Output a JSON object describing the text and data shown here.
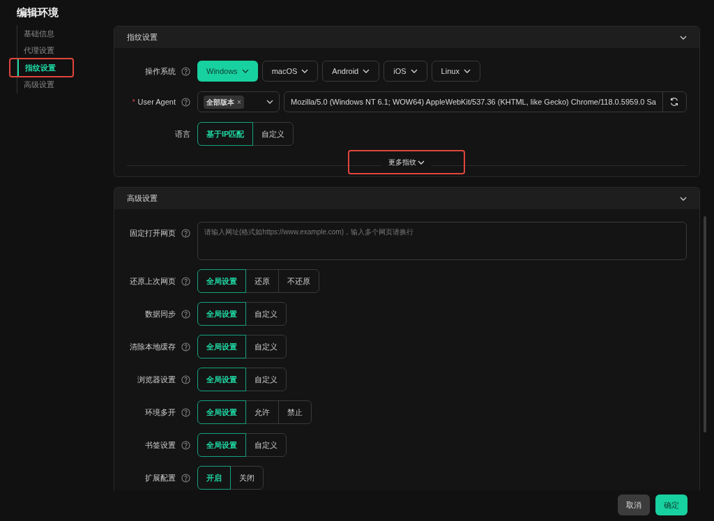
{
  "title": "编辑环境",
  "sidebar": {
    "items": [
      {
        "label": "基础信息",
        "selected": false
      },
      {
        "label": "代理设置",
        "selected": false
      },
      {
        "label": "指纹设置",
        "selected": true,
        "highlighted": true
      },
      {
        "label": "高级设置",
        "selected": false
      }
    ]
  },
  "fingerprint_section": {
    "title": "指纹设置",
    "os": {
      "label": "操作系统",
      "options": [
        {
          "label": "Windows",
          "selected": true
        },
        {
          "label": "macOS",
          "selected": false
        },
        {
          "label": "Android",
          "selected": false
        },
        {
          "label": "iOS",
          "selected": false
        },
        {
          "label": "Linux",
          "selected": false
        }
      ]
    },
    "user_agent": {
      "marker": "*",
      "label": "User Agent",
      "tag": "全部版本",
      "tag_close": "×",
      "value": "Mozilla/5.0 (Windows NT 6.1; WOW64) AppleWebKit/537.36 (KHTML, like Gecko) Chrome/118.0.5959.0 Sa"
    },
    "language": {
      "label": "语言",
      "options": [
        {
          "label": "基于IP匹配",
          "selected": true
        },
        {
          "label": "自定义",
          "selected": false
        }
      ]
    },
    "more_button": {
      "label": "更多指纹",
      "highlighted": true
    }
  },
  "advanced_section": {
    "title": "高级设置",
    "fixed_pages": {
      "label": "固定打开网页",
      "placeholder": "请输入网址(格式如https://www.example.com)，输入多个网页请换行"
    },
    "rows": [
      {
        "label": "还原上次网页",
        "options": [
          {
            "label": "全局设置",
            "selected": true
          },
          {
            "label": "还原",
            "selected": false
          },
          {
            "label": "不还原",
            "selected": false
          }
        ]
      },
      {
        "label": "数据同步",
        "options": [
          {
            "label": "全局设置",
            "selected": true
          },
          {
            "label": "自定义",
            "selected": false
          }
        ]
      },
      {
        "label": "清除本地缓存",
        "options": [
          {
            "label": "全局设置",
            "selected": true
          },
          {
            "label": "自定义",
            "selected": false
          }
        ]
      },
      {
        "label": "浏览器设置",
        "options": [
          {
            "label": "全局设置",
            "selected": true
          },
          {
            "label": "自定义",
            "selected": false
          }
        ]
      },
      {
        "label": "环境多开",
        "options": [
          {
            "label": "全局设置",
            "selected": true
          },
          {
            "label": "允许",
            "selected": false
          },
          {
            "label": "禁止",
            "selected": false
          }
        ]
      },
      {
        "label": "书签设置",
        "options": [
          {
            "label": "全局设置",
            "selected": true
          },
          {
            "label": "自定义",
            "selected": false
          }
        ]
      },
      {
        "label": "扩展配置",
        "options": [
          {
            "label": "开启",
            "selected": true
          },
          {
            "label": "关闭",
            "selected": false
          }
        ]
      }
    ]
  },
  "footer": {
    "buttons": [
      {
        "label": "取消",
        "kind": "secondary"
      },
      {
        "label": "确定",
        "kind": "primary"
      }
    ]
  }
}
